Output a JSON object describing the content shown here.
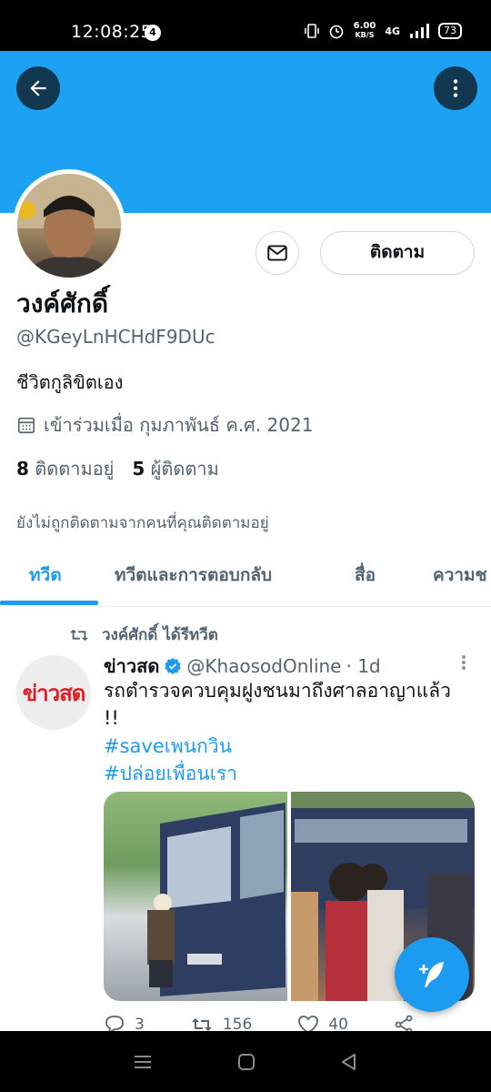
{
  "status_bar": {
    "time": "12:08:25",
    "notification_count": "4",
    "speed": "6.00",
    "speed_unit": "KB/S",
    "network": "4G",
    "battery": "73"
  },
  "profile": {
    "display_name": "วงค์ศักดิ์",
    "handle": "@KGeyLnHCHdF9DUc",
    "bio": "ชีวิตกูลิขิตเอง",
    "joined": "เข้าร่วมเมื่อ กุมภาพันธ์ ค.ศ. 2021",
    "following_count": "8",
    "following_label": "ติดตามอยู่",
    "followers_count": "5",
    "followers_label": "ผู้ติดตาม",
    "not_followed_note": "ยังไม่ถูกติดตามจากคนที่คุณติดตามอยู่",
    "follow_button": "ติดตาม"
  },
  "tabs": [
    {
      "label": "ทวีต",
      "active": true
    },
    {
      "label": "ทวีตและการตอบกลับ",
      "active": false
    },
    {
      "label": "สื่อ",
      "active": false
    },
    {
      "label": "ความช",
      "active": false
    }
  ],
  "tweet": {
    "retweeted_by": "วงค์ศักดิ์ ได้รีทวีต",
    "avatar_text": "ข่าวสด",
    "author_name": "ข่าวสด",
    "author_handle": "@KhaosodOnline",
    "time": "· 1d",
    "text": "รถตำรวจควบคุมฝูงชนมาถึงศาลอาญาแล้ว !!",
    "hashtags": [
      "#saveเพนกวิน",
      "#ปล่อยเพื่อนเรา"
    ],
    "replies": "3",
    "retweets": "156",
    "likes": "40"
  },
  "colors": {
    "accent": "#1d9bf0",
    "banner": "#1da1f2"
  }
}
